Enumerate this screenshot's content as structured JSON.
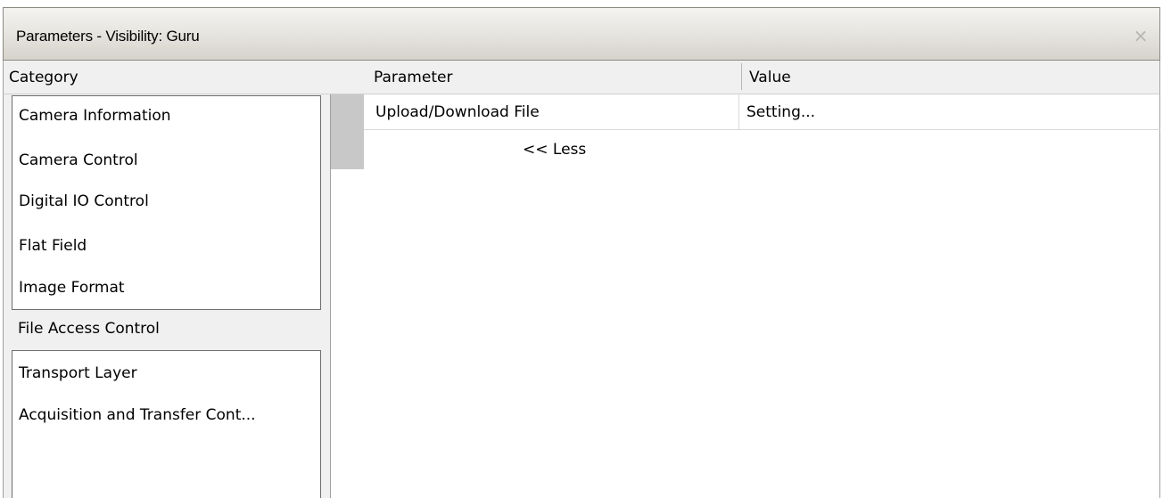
{
  "window": {
    "title": "Parameters - Visibility: Guru",
    "close_icon": "×"
  },
  "header": {
    "category": "Category",
    "parameter": "Parameter",
    "value": "Value"
  },
  "categories": [
    "Camera Information",
    "Camera Control",
    "Digital IO Control",
    "Flat Field",
    "Image Format",
    "File Access Control",
    "Transport Layer",
    "Acquisition and Transfer Cont..."
  ],
  "selected_category": "File Access Control",
  "parameters": [
    {
      "name": "Upload/Download File",
      "value": "Setting..."
    }
  ],
  "less_link": "<< Less"
}
